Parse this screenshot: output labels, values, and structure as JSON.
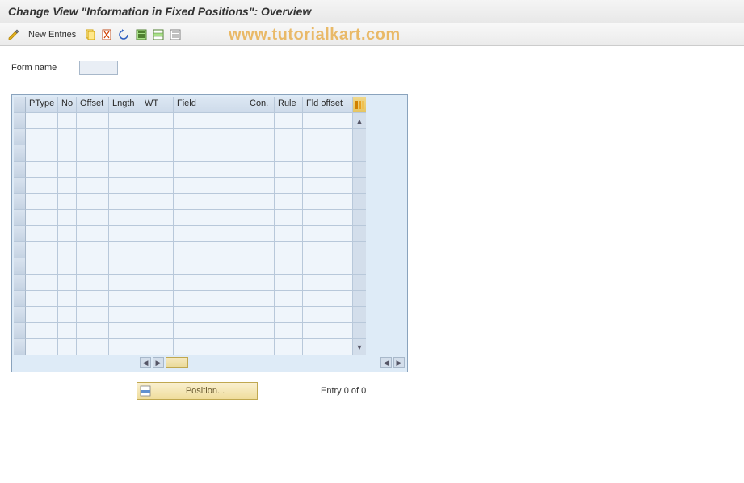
{
  "title": "Change View \"Information in Fixed Positions\": Overview",
  "toolbar": {
    "new_entries": "New Entries"
  },
  "watermark": "www.tutorialkart.com",
  "form": {
    "label": "Form name",
    "value": ""
  },
  "table": {
    "headers": {
      "ptype": "PType",
      "no": "No",
      "offset": "Offset",
      "lngth": "Lngth",
      "wt": "WT",
      "field": "Field",
      "con": "Con.",
      "rule": "Rule",
      "fldoffset": "Fld offset"
    }
  },
  "footer": {
    "position_btn": "Position...",
    "entry_text": "Entry 0 of 0"
  }
}
